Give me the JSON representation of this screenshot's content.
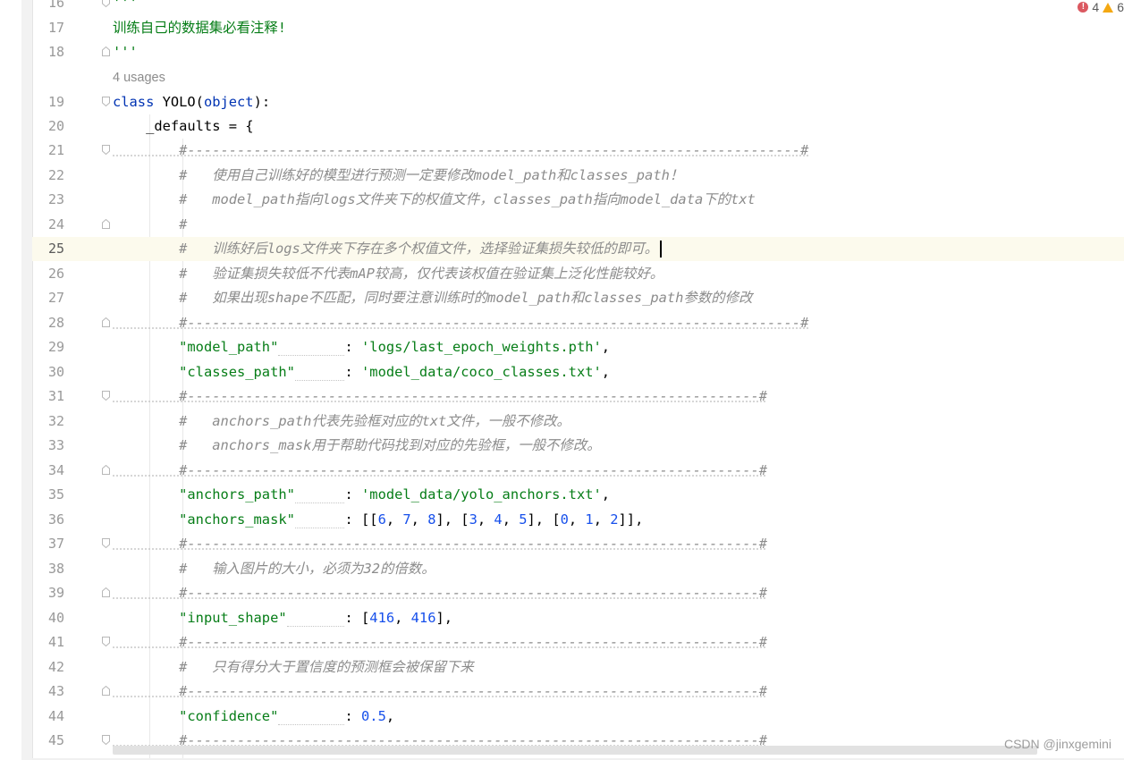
{
  "inspections": {
    "errors": "4",
    "warnings": "6"
  },
  "usages_hint": "4 usages",
  "watermark": "CSDN @jinxgemini",
  "lines": [
    {
      "n": "16",
      "tokens": [
        {
          "t": "'''",
          "c": "doc"
        }
      ]
    },
    {
      "n": "17",
      "tokens": [
        {
          "t": "训练自己的数据集必看注释!",
          "c": "doc"
        }
      ]
    },
    {
      "n": "18",
      "tokens": [
        {
          "t": "'''",
          "c": "doc"
        }
      ]
    },
    {
      "n": "19",
      "tokens": [
        {
          "t": "class",
          "c": "kw"
        },
        {
          "t": " YOLO(",
          "c": "def"
        },
        {
          "t": "object",
          "c": "builtin"
        },
        {
          "t": "):",
          "c": "def"
        }
      ]
    },
    {
      "n": "20",
      "tokens": [
        {
          "t": "    _defaults = {",
          "c": "def"
        }
      ]
    },
    {
      "n": "21",
      "tokens": [
        {
          "t": "        #--------------------------------------------------------------------------#",
          "c": "cm"
        }
      ]
    },
    {
      "n": "22",
      "tokens": [
        {
          "t": "        #   使用自己训练好的模型进行预测一定要修改model_path和classes_path！",
          "c": "cm"
        }
      ]
    },
    {
      "n": "23",
      "tokens": [
        {
          "t": "        #   model_path指向logs文件夹下的权值文件，classes_path指向model_data下的txt",
          "c": "cm"
        }
      ]
    },
    {
      "n": "24",
      "tokens": [
        {
          "t": "        #",
          "c": "cm"
        }
      ]
    },
    {
      "n": "25",
      "current": true,
      "tokens": [
        {
          "t": "        #   训练好后logs文件夹下存在多个权值文件，选择验证集损失较低的即可。",
          "c": "cm"
        }
      ]
    },
    {
      "n": "26",
      "tokens": [
        {
          "t": "        #   验证集损失较低不代表mAP较高，仅代表该权值在验证集上泛化性能较好。",
          "c": "cm"
        }
      ]
    },
    {
      "n": "27",
      "tokens": [
        {
          "t": "        #   如果出现shape不匹配，同时要注意训练时的model_path和classes_path参数的修改",
          "c": "cm"
        }
      ]
    },
    {
      "n": "28",
      "tokens": [
        {
          "t": "        #--------------------------------------------------------------------------#",
          "c": "cm"
        }
      ]
    },
    {
      "n": "29",
      "tokens": [
        {
          "t": "        ",
          "c": "def"
        },
        {
          "t": "\"model_path\"",
          "c": "str"
        },
        {
          "t": "        ",
          "c": "pad"
        },
        {
          "t": ": ",
          "c": "def"
        },
        {
          "t": "'logs/last_epoch_weights.pth'",
          "c": "str"
        },
        {
          "t": ",",
          "c": "def"
        }
      ]
    },
    {
      "n": "30",
      "tokens": [
        {
          "t": "        ",
          "c": "def"
        },
        {
          "t": "\"classes_path\"",
          "c": "str"
        },
        {
          "t": "      ",
          "c": "pad"
        },
        {
          "t": ": ",
          "c": "def"
        },
        {
          "t": "'model_data/coco_classes.txt'",
          "c": "str"
        },
        {
          "t": ",",
          "c": "def"
        }
      ]
    },
    {
      "n": "31",
      "tokens": [
        {
          "t": "        #---------------------------------------------------------------------#",
          "c": "cm"
        }
      ]
    },
    {
      "n": "32",
      "tokens": [
        {
          "t": "        #   anchors_path代表先验框对应的txt文件，一般不修改。",
          "c": "cm"
        }
      ]
    },
    {
      "n": "33",
      "tokens": [
        {
          "t": "        #   anchors_mask用于帮助代码找到对应的先验框，一般不修改。",
          "c": "cm"
        }
      ]
    },
    {
      "n": "34",
      "tokens": [
        {
          "t": "        #---------------------------------------------------------------------#",
          "c": "cm"
        }
      ]
    },
    {
      "n": "35",
      "tokens": [
        {
          "t": "        ",
          "c": "def"
        },
        {
          "t": "\"anchors_path\"",
          "c": "str"
        },
        {
          "t": "      ",
          "c": "pad"
        },
        {
          "t": ": ",
          "c": "def"
        },
        {
          "t": "'model_data/yolo_anchors.txt'",
          "c": "str"
        },
        {
          "t": ",",
          "c": "def"
        }
      ]
    },
    {
      "n": "36",
      "tokens": [
        {
          "t": "        ",
          "c": "def"
        },
        {
          "t": "\"anchors_mask\"",
          "c": "str"
        },
        {
          "t": "      ",
          "c": "pad"
        },
        {
          "t": ": [[",
          "c": "def"
        },
        {
          "t": "6",
          "c": "num"
        },
        {
          "t": ", ",
          "c": "def"
        },
        {
          "t": "7",
          "c": "num"
        },
        {
          "t": ", ",
          "c": "def"
        },
        {
          "t": "8",
          "c": "num"
        },
        {
          "t": "], [",
          "c": "def"
        },
        {
          "t": "3",
          "c": "num"
        },
        {
          "t": ", ",
          "c": "def"
        },
        {
          "t": "4",
          "c": "num"
        },
        {
          "t": ", ",
          "c": "def"
        },
        {
          "t": "5",
          "c": "num"
        },
        {
          "t": "], [",
          "c": "def"
        },
        {
          "t": "0",
          "c": "num"
        },
        {
          "t": ", ",
          "c": "def"
        },
        {
          "t": "1",
          "c": "num"
        },
        {
          "t": ", ",
          "c": "def"
        },
        {
          "t": "2",
          "c": "num"
        },
        {
          "t": "]],",
          "c": "def"
        }
      ]
    },
    {
      "n": "37",
      "tokens": [
        {
          "t": "        #---------------------------------------------------------------------#",
          "c": "cm"
        }
      ]
    },
    {
      "n": "38",
      "tokens": [
        {
          "t": "        #   输入图片的大小，必须为32的倍数。",
          "c": "cm"
        }
      ]
    },
    {
      "n": "39",
      "tokens": [
        {
          "t": "        #---------------------------------------------------------------------#",
          "c": "cm"
        }
      ]
    },
    {
      "n": "40",
      "tokens": [
        {
          "t": "        ",
          "c": "def"
        },
        {
          "t": "\"input_shape\"",
          "c": "str"
        },
        {
          "t": "       ",
          "c": "pad"
        },
        {
          "t": ": [",
          "c": "def"
        },
        {
          "t": "416",
          "c": "num"
        },
        {
          "t": ", ",
          "c": "def"
        },
        {
          "t": "416",
          "c": "num"
        },
        {
          "t": "],",
          "c": "def"
        }
      ]
    },
    {
      "n": "41",
      "tokens": [
        {
          "t": "        #---------------------------------------------------------------------#",
          "c": "cm"
        }
      ]
    },
    {
      "n": "42",
      "tokens": [
        {
          "t": "        #   只有得分大于置信度的预测框会被保留下来",
          "c": "cm"
        }
      ]
    },
    {
      "n": "43",
      "tokens": [
        {
          "t": "        #---------------------------------------------------------------------#",
          "c": "cm"
        }
      ]
    },
    {
      "n": "44",
      "tokens": [
        {
          "t": "        ",
          "c": "def"
        },
        {
          "t": "\"confidence\"",
          "c": "str"
        },
        {
          "t": "        ",
          "c": "pad"
        },
        {
          "t": ": ",
          "c": "def"
        },
        {
          "t": "0.5",
          "c": "num"
        },
        {
          "t": ",",
          "c": "def"
        }
      ]
    },
    {
      "n": "45",
      "tokens": [
        {
          "t": "        #---------------------------------------------------------------------#",
          "c": "cm"
        }
      ]
    }
  ]
}
